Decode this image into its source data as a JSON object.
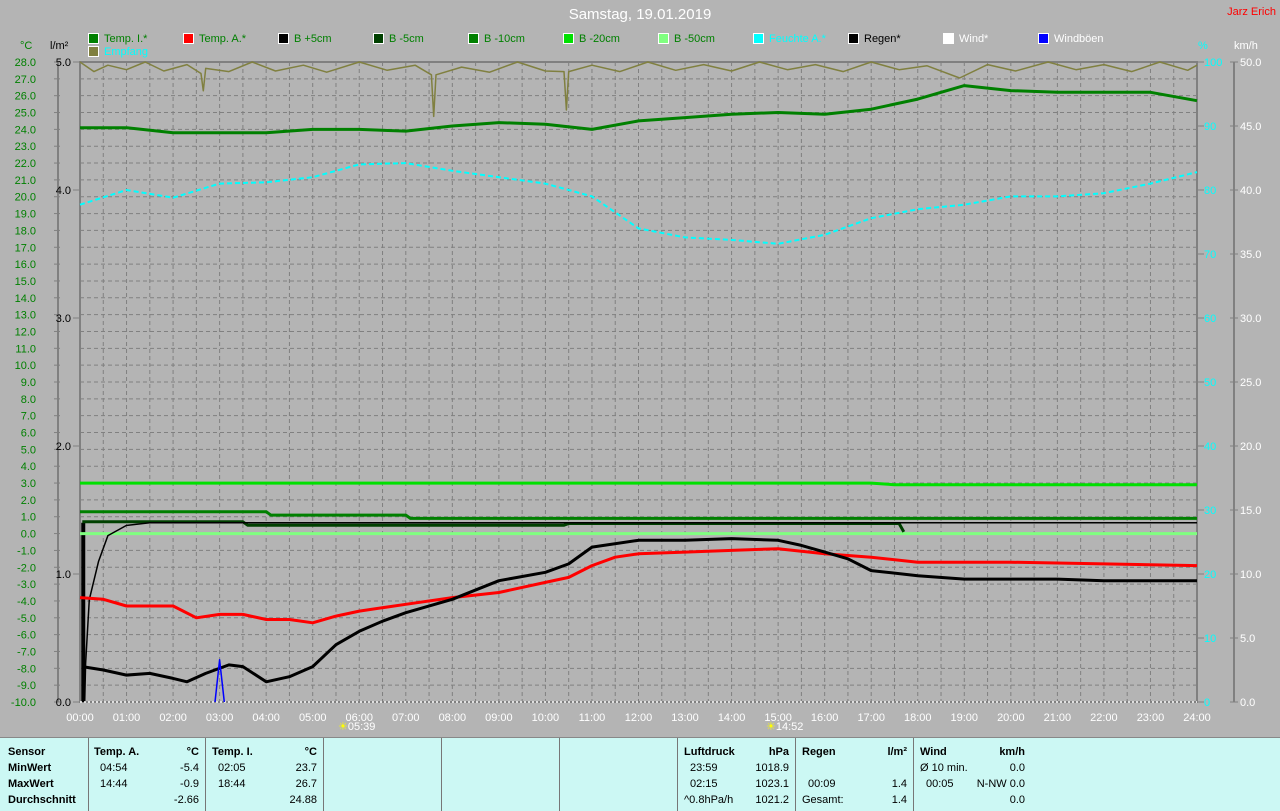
{
  "header": {
    "title": "Samstag, 19.01.2019",
    "author": "Jarz Erich"
  },
  "legend": [
    {
      "label": "Temp. I.*",
      "color": "#008000",
      "text_color": "#008000"
    },
    {
      "label": "Temp. A.*",
      "color": "#ff0000",
      "text_color": "#008000"
    },
    {
      "label": "B +5cm",
      "color": "#000000",
      "text_color": "#008000"
    },
    {
      "label": "B -5cm",
      "color": "#004000",
      "text_color": "#008000"
    },
    {
      "label": "B -10cm",
      "color": "#008000",
      "text_color": "#008000"
    },
    {
      "label": "B -20cm",
      "color": "#00e000",
      "text_color": "#008000"
    },
    {
      "label": "B -50cm",
      "color": "#80ff80",
      "text_color": "#008000"
    },
    {
      "label": "Feuchte A.*",
      "color": "#00ffff",
      "text_color": "#00ffff"
    },
    {
      "label": "Regen*",
      "color": "#000000",
      "text_color": "#000000"
    },
    {
      "label": "Wind*",
      "color": "#ffffff",
      "text_color": "#ffffff"
    },
    {
      "label": "Windböen",
      "color": "#0000ff",
      "text_color": "#ffffff"
    },
    {
      "label": "Empfang",
      "color": "#808040",
      "text_color": "#00ffff"
    }
  ],
  "axes": {
    "celsius_unit": "°C",
    "rain_unit": "l/m²",
    "percent_unit": "%",
    "wind_unit": "km/h"
  },
  "markers": {
    "sunrise": "05:39",
    "sunset": "14:52"
  },
  "chart_data": {
    "type": "line",
    "title": "Samstag, 19.01.2019",
    "x_ticks": [
      "00:00",
      "01:00",
      "02:00",
      "03:00",
      "04:00",
      "05:00",
      "06:00",
      "07:00",
      "08:00",
      "09:00",
      "10:00",
      "11:00",
      "12:00",
      "13:00",
      "14:00",
      "15:00",
      "16:00",
      "17:00",
      "18:00",
      "19:00",
      "20:00",
      "21:00",
      "22:00",
      "23:00",
      "24:00"
    ],
    "xlim_hours": [
      0,
      24
    ],
    "y_axes": {
      "celsius": {
        "range": [
          -10,
          28
        ],
        "ticks": [
          "28.0",
          "27.0",
          "26.0",
          "25.0",
          "24.0",
          "23.0",
          "22.0",
          "21.0",
          "20.0",
          "19.0",
          "18.0",
          "17.0",
          "16.0",
          "15.0",
          "14.0",
          "13.0",
          "12.0",
          "11.0",
          "10.0",
          "9.0",
          "8.0",
          "7.0",
          "6.0",
          "5.0",
          "4.0",
          "3.0",
          "2.0",
          "1.0",
          "0.0",
          "-1.0",
          "-2.0",
          "-3.0",
          "-4.0",
          "-5.0",
          "-6.0",
          "-7.0",
          "-8.0",
          "-9.0",
          "-10.0"
        ]
      },
      "rain": {
        "range": [
          0,
          5
        ],
        "ticks": [
          "5.0",
          "4.0",
          "3.0",
          "2.0",
          "1.0",
          "0.0"
        ]
      },
      "percent": {
        "range": [
          0,
          100
        ],
        "ticks": [
          "100",
          "90",
          "80",
          "70",
          "60",
          "50",
          "40",
          "30",
          "20",
          "10",
          "0"
        ]
      },
      "wind": {
        "range": [
          0,
          50
        ],
        "ticks": [
          "50.0",
          "45.0",
          "40.0",
          "35.0",
          "30.0",
          "25.0",
          "20.0",
          "15.0",
          "10.0",
          "5.0",
          "0.0"
        ]
      }
    },
    "grid": true,
    "series": [
      {
        "name": "Temp. I.*",
        "axis": "celsius",
        "color": "#008000",
        "points": [
          [
            0,
            24.1
          ],
          [
            1,
            24.1
          ],
          [
            2,
            23.8
          ],
          [
            3,
            23.8
          ],
          [
            4,
            23.8
          ],
          [
            5,
            24.0
          ],
          [
            6,
            24.0
          ],
          [
            7,
            23.9
          ],
          [
            8,
            24.2
          ],
          [
            9,
            24.4
          ],
          [
            10,
            24.3
          ],
          [
            11,
            24.0
          ],
          [
            12,
            24.5
          ],
          [
            13,
            24.7
          ],
          [
            14,
            24.9
          ],
          [
            15,
            25.0
          ],
          [
            16,
            24.9
          ],
          [
            17,
            25.2
          ],
          [
            18,
            25.8
          ],
          [
            19,
            26.6
          ],
          [
            20,
            26.3
          ],
          [
            21,
            26.2
          ],
          [
            22,
            26.2
          ],
          [
            23,
            26.2
          ],
          [
            24,
            25.7
          ]
        ]
      },
      {
        "name": "Temp. A.*",
        "axis": "celsius",
        "color": "#ff0000",
        "points": [
          [
            0,
            -3.8
          ],
          [
            0.5,
            -3.9
          ],
          [
            1,
            -4.3
          ],
          [
            2,
            -4.3
          ],
          [
            2.5,
            -5.0
          ],
          [
            3,
            -4.8
          ],
          [
            3.5,
            -4.8
          ],
          [
            4,
            -5.1
          ],
          [
            4.5,
            -5.1
          ],
          [
            5,
            -5.3
          ],
          [
            5.5,
            -4.9
          ],
          [
            6,
            -4.6
          ],
          [
            7,
            -4.2
          ],
          [
            8,
            -3.8
          ],
          [
            9,
            -3.5
          ],
          [
            10,
            -2.9
          ],
          [
            10.5,
            -2.6
          ],
          [
            11,
            -1.9
          ],
          [
            11.5,
            -1.4
          ],
          [
            12,
            -1.2
          ],
          [
            13,
            -1.1
          ],
          [
            14,
            -1.0
          ],
          [
            15,
            -0.9
          ],
          [
            16,
            -1.2
          ],
          [
            17,
            -1.4
          ],
          [
            18,
            -1.7
          ],
          [
            20,
            -1.7
          ],
          [
            22,
            -1.8
          ],
          [
            24,
            -1.9
          ]
        ]
      },
      {
        "name": "B +5cm",
        "axis": "celsius",
        "color": "#000000",
        "points": [
          [
            0.05,
            -7.9
          ],
          [
            0.5,
            -8.1
          ],
          [
            1,
            -8.4
          ],
          [
            1.5,
            -8.3
          ],
          [
            2,
            -8.6
          ],
          [
            2.3,
            -8.8
          ],
          [
            2.7,
            -8.3
          ],
          [
            3.2,
            -7.8
          ],
          [
            3.5,
            -7.9
          ],
          [
            4,
            -8.8
          ],
          [
            4.5,
            -8.5
          ],
          [
            5,
            -7.9
          ],
          [
            5.5,
            -6.6
          ],
          [
            6,
            -5.8
          ],
          [
            6.5,
            -5.2
          ],
          [
            7,
            -4.7
          ],
          [
            8,
            -3.9
          ],
          [
            9,
            -2.8
          ],
          [
            10,
            -2.3
          ],
          [
            10.5,
            -1.8
          ],
          [
            11,
            -0.8
          ],
          [
            12,
            -0.4
          ],
          [
            13,
            -0.4
          ],
          [
            14,
            -0.3
          ],
          [
            15,
            -0.4
          ],
          [
            15.5,
            -0.7
          ],
          [
            16,
            -1.1
          ],
          [
            16.5,
            -1.5
          ],
          [
            17,
            -2.2
          ],
          [
            18,
            -2.5
          ],
          [
            19,
            -2.7
          ],
          [
            20,
            -2.7
          ],
          [
            21,
            -2.7
          ],
          [
            22,
            -2.8
          ],
          [
            24,
            -2.8
          ]
        ]
      },
      {
        "name": "B -5cm",
        "axis": "celsius",
        "color": "#004000",
        "points": [
          [
            0.05,
            0.7
          ],
          [
            3.5,
            0.7
          ],
          [
            3.6,
            0.5
          ],
          [
            10.4,
            0.5
          ],
          [
            10.5,
            0.6
          ],
          [
            17.6,
            0.6
          ],
          [
            17.7,
            0.1
          ]
        ]
      },
      {
        "name": "B -10cm",
        "axis": "celsius",
        "color": "#008000",
        "points": [
          [
            0,
            1.3
          ],
          [
            4,
            1.3
          ],
          [
            4.1,
            1.1
          ],
          [
            7,
            1.1
          ],
          [
            7.1,
            0.9
          ],
          [
            24,
            0.9
          ]
        ]
      },
      {
        "name": "B -20cm",
        "axis": "celsius",
        "color": "#00e000",
        "points": [
          [
            0,
            3.0
          ],
          [
            17,
            3.0
          ],
          [
            17.5,
            2.9
          ],
          [
            24,
            2.9
          ]
        ]
      },
      {
        "name": "B -50cm",
        "axis": "celsius",
        "color": "#80ff80",
        "points": [
          [
            0,
            0.0
          ],
          [
            24,
            0.0
          ]
        ]
      },
      {
        "name": "Feuchte A.*",
        "axis": "percent",
        "color": "#00ffff",
        "points": [
          [
            0,
            77.7
          ],
          [
            1,
            80
          ],
          [
            2,
            78.8
          ],
          [
            3,
            81
          ],
          [
            4,
            81.2
          ],
          [
            5,
            82
          ],
          [
            6,
            84
          ],
          [
            7,
            84.2
          ],
          [
            8,
            83
          ],
          [
            9,
            82
          ],
          [
            10,
            81
          ],
          [
            11,
            79
          ],
          [
            12,
            74
          ],
          [
            13,
            72.6
          ],
          [
            14,
            72.2
          ],
          [
            15,
            71.6
          ],
          [
            16,
            73
          ],
          [
            17,
            75.6
          ],
          [
            18,
            77
          ],
          [
            19,
            77.7
          ],
          [
            20,
            79
          ],
          [
            21,
            79
          ],
          [
            22,
            79.5
          ],
          [
            23,
            81
          ],
          [
            24,
            82.8
          ]
        ]
      },
      {
        "name": "Regen*",
        "axis": "rain",
        "color": "#000000",
        "points": [
          [
            0.1,
            0
          ],
          [
            0.12,
            0.3
          ],
          [
            0.2,
            0.8
          ],
          [
            0.4,
            1.1
          ],
          [
            0.6,
            1.3
          ],
          [
            1,
            1.38
          ],
          [
            1.5,
            1.4
          ],
          [
            24,
            1.4
          ]
        ]
      },
      {
        "name": "Wind*",
        "axis": "wind",
        "color": "#ffffff",
        "points": [
          [
            0,
            0
          ],
          [
            24,
            0
          ]
        ]
      },
      {
        "name": "Windböen",
        "axis": "wind",
        "color": "#0000ff",
        "points": [
          [
            2.9,
            0
          ],
          [
            3.0,
            3.3
          ],
          [
            3.1,
            0
          ]
        ]
      },
      {
        "name": "Empfang",
        "axis": "percent",
        "color": "#808040",
        "points": [
          [
            0,
            100
          ],
          [
            0.3,
            98.5
          ],
          [
            0.6,
            99.5
          ],
          [
            1,
            98.8
          ],
          [
            1.4,
            100
          ],
          [
            1.8,
            98.6
          ],
          [
            2.3,
            99.6
          ],
          [
            2.6,
            98.2
          ],
          [
            2.65,
            95.5
          ],
          [
            2.7,
            99
          ],
          [
            3.2,
            98.5
          ],
          [
            3.7,
            100
          ],
          [
            4.2,
            98.6
          ],
          [
            4.8,
            99.5
          ],
          [
            5.3,
            98.4
          ],
          [
            6,
            100
          ],
          [
            6.6,
            98.7
          ],
          [
            7.2,
            99.5
          ],
          [
            7.55,
            98
          ],
          [
            7.6,
            91.5
          ],
          [
            7.65,
            98
          ],
          [
            8.2,
            99.2
          ],
          [
            8.8,
            98.4
          ],
          [
            9.4,
            100
          ],
          [
            10,
            98.6
          ],
          [
            10.4,
            98.5
          ],
          [
            10.45,
            92.5
          ],
          [
            10.5,
            98.5
          ],
          [
            11,
            99.5
          ],
          [
            11.6,
            98.5
          ],
          [
            12.2,
            100
          ],
          [
            12.8,
            98.7
          ],
          [
            13.4,
            99.6
          ],
          [
            14,
            98.6
          ],
          [
            14.6,
            100
          ],
          [
            15.2,
            98.8
          ],
          [
            15.8,
            99.6
          ],
          [
            16.4,
            98.5
          ],
          [
            17,
            100
          ],
          [
            17.6,
            98.8
          ],
          [
            18.2,
            99.4
          ],
          [
            18.9,
            97.5
          ],
          [
            19.5,
            99.6
          ],
          [
            20.1,
            98.6
          ],
          [
            20.8,
            100
          ],
          [
            21.4,
            98.8
          ],
          [
            22,
            99.6
          ],
          [
            22.6,
            98.5
          ],
          [
            23.2,
            100
          ],
          [
            23.8,
            98.7
          ],
          [
            24,
            99.5
          ]
        ]
      }
    ]
  },
  "stats": {
    "row_labels": [
      "Sensor",
      "MinWert",
      "MaxWert",
      "Durchschnitt"
    ],
    "temp_a": {
      "header": "Temp. A.",
      "unit": "°C",
      "min_time": "04:54",
      "min": "-5.4",
      "max_time": "14:44",
      "max": "-0.9",
      "avg": "-2.66"
    },
    "temp_i": {
      "header": "Temp. I.",
      "unit": "°C",
      "min_time": "02:05",
      "min": "23.7",
      "max_time": "18:44",
      "max": "26.7",
      "avg": "24.88"
    },
    "pressure": {
      "header": "Luftdruck",
      "unit": "hPa",
      "min_time": "23:59",
      "min": "1018.9",
      "max_time": "02:15",
      "max": "1023.1",
      "trend": "^0.8hPa/h",
      "avg": "1021.2"
    },
    "rain": {
      "header": "Regen",
      "unit": "l/m²",
      "max_time": "00:09",
      "max": "1.4",
      "total_label": "Gesamt:",
      "total": "1.4"
    },
    "wind": {
      "header": "Wind",
      "unit": "km/h",
      "avg_label": "Ø 10 min.",
      "avg": "0.0",
      "max_time": "00:05",
      "max": "N-NW 0.0",
      "total": "0.0"
    }
  }
}
